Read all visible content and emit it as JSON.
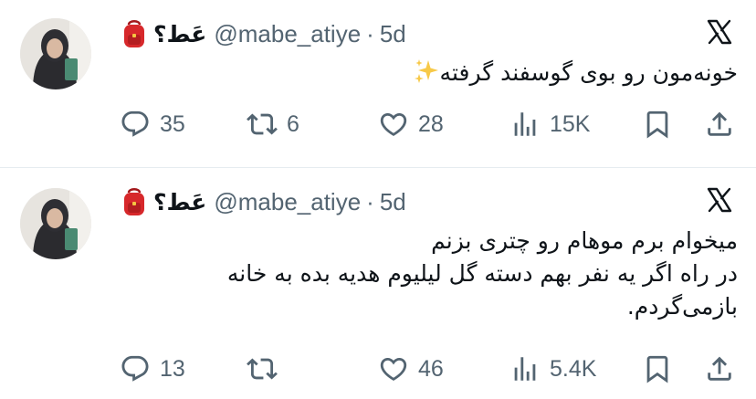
{
  "tweets": [
    {
      "author": {
        "display_name": "عَط؟",
        "handle": "@mabe_atiye",
        "emoji": "backpack-emoji"
      },
      "separator": "·",
      "time": "5d",
      "text_lines": [
        "خونه‌مون رو بوی گوسفند گرفته"
      ],
      "trailing_emoji": "sparkles-emoji",
      "actions": {
        "replies": "35",
        "retweets": "6",
        "likes": "28",
        "views": "15K"
      }
    },
    {
      "author": {
        "display_name": "عَط؟",
        "handle": "@mabe_atiye",
        "emoji": "backpack-emoji"
      },
      "separator": "·",
      "time": "5d",
      "text_lines": [
        "میخوام برم موهام رو چتری بزنم",
        "در راه اگر یه نفر بهم دسته گل لیلیوم هدیه بده به خانه",
        "بازمی‌گردم."
      ],
      "actions": {
        "replies": "13",
        "retweets": "",
        "likes": "46",
        "views": "5.4K"
      }
    }
  ],
  "colors": {
    "text_primary": "#0f1419",
    "text_secondary": "#536471",
    "divider": "#e6ecf0"
  },
  "icons": [
    "x-logo-icon",
    "reply-icon",
    "retweet-icon",
    "like-icon",
    "views-icon",
    "bookmark-icon",
    "share-icon"
  ]
}
